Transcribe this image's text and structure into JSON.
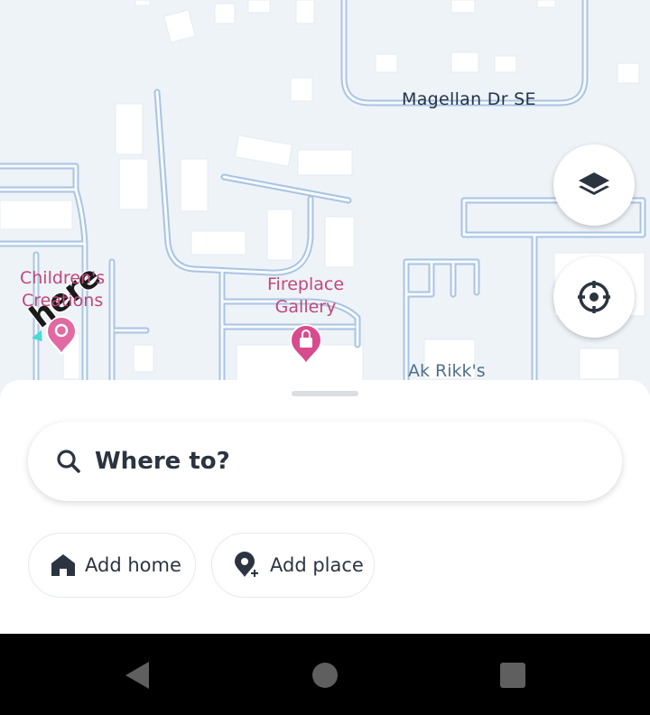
{
  "map": {
    "street_label": "Magellan Dr SE",
    "pois": {
      "childrens": "Children's Creations",
      "childrens_line1": "Children's",
      "childrens_line2": "Creations",
      "fireplace_line1": "Fireplace",
      "fireplace_line2": "Gallery",
      "akrikk": "Ak Rikk's"
    },
    "logo_text": "here",
    "colors": {
      "land": "#eef3f8",
      "road_fill": "#f7fafd",
      "road_casing": "#a9c4e2",
      "building": "#ffffff",
      "poi_pink": "#d84b8e"
    }
  },
  "controls": {
    "layers_icon": "layers-icon",
    "locate_icon": "locate-crosshair-icon"
  },
  "sheet": {
    "search_placeholder": "Where to?",
    "chips": {
      "home_label": "Add home",
      "place_label": "Add place"
    }
  },
  "system_nav": {
    "back_icon": "back-triangle-icon",
    "home_icon": "home-circle-icon",
    "recents_icon": "recents-square-icon"
  }
}
